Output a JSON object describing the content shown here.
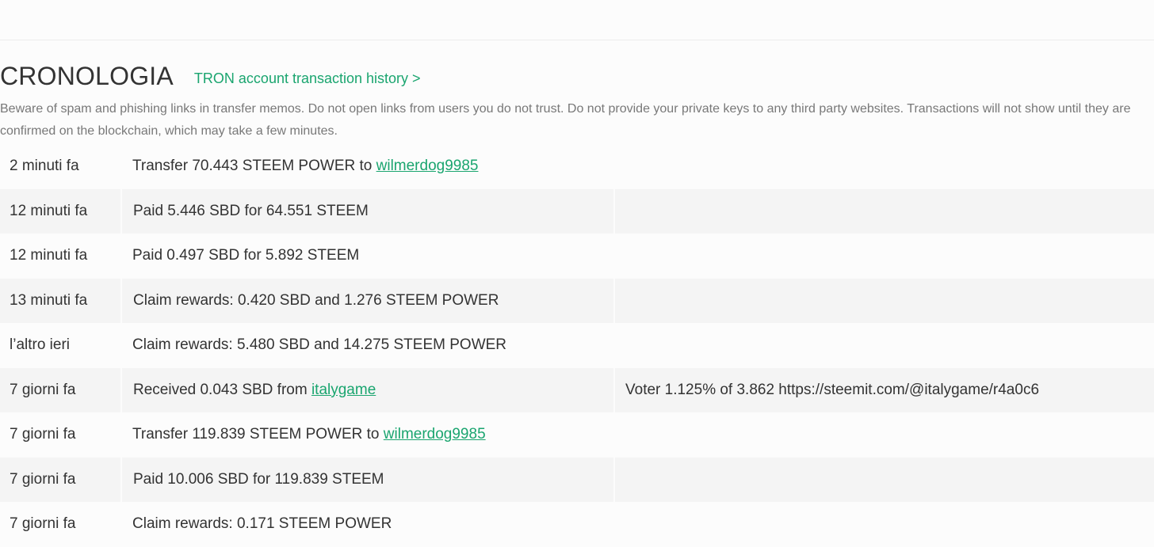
{
  "history": {
    "title": "CRONOLOGIA",
    "tron_link": "TRON account transaction history >",
    "notice": "Beware of spam and phishing links in transfer memos. Do not open links from users you do not trust. Do not provide your private keys to any third party websites. Transactions will not show until they are confirmed on the blockchain, which may take a few minutes.",
    "rows": [
      {
        "time": "2 minuti fa",
        "desc": "Transfer 70.443 STEEM POWER to ",
        "link": "wilmerdog9985",
        "memo": ""
      },
      {
        "time": "12 minuti fa",
        "desc": "Paid 5.446 SBD for 64.551 STEEM",
        "link": "",
        "memo": ""
      },
      {
        "time": "12 minuti fa",
        "desc": "Paid 0.497 SBD for 5.892 STEEM",
        "link": "",
        "memo": ""
      },
      {
        "time": "13 minuti fa",
        "desc": "Claim rewards: 0.420 SBD and 1.276 STEEM POWER",
        "link": "",
        "memo": ""
      },
      {
        "time": "l’altro ieri",
        "desc": "Claim rewards: 5.480 SBD and 14.275 STEEM POWER",
        "link": "",
        "memo": ""
      },
      {
        "time": "7 giorni fa",
        "desc": "Received 0.043 SBD from ",
        "link": "italygame",
        "memo": "Voter 1.125% of 3.862 https://steemit.com/@italygame/r4a0c6"
      },
      {
        "time": "7 giorni fa",
        "desc": "Transfer 119.839 STEEM POWER to ",
        "link": "wilmerdog9985",
        "memo": ""
      },
      {
        "time": "7 giorni fa",
        "desc": "Paid 10.006 SBD for 119.839 STEEM",
        "link": "",
        "memo": ""
      },
      {
        "time": "7 giorni fa",
        "desc": "Claim rewards: 0.171 STEEM POWER",
        "link": "",
        "memo": ""
      }
    ]
  },
  "colors": {
    "link": "#1aa56f",
    "text": "#333333",
    "muted": "#787878",
    "row_alt": "#f4f4f4",
    "background": "#fcfcfc"
  }
}
